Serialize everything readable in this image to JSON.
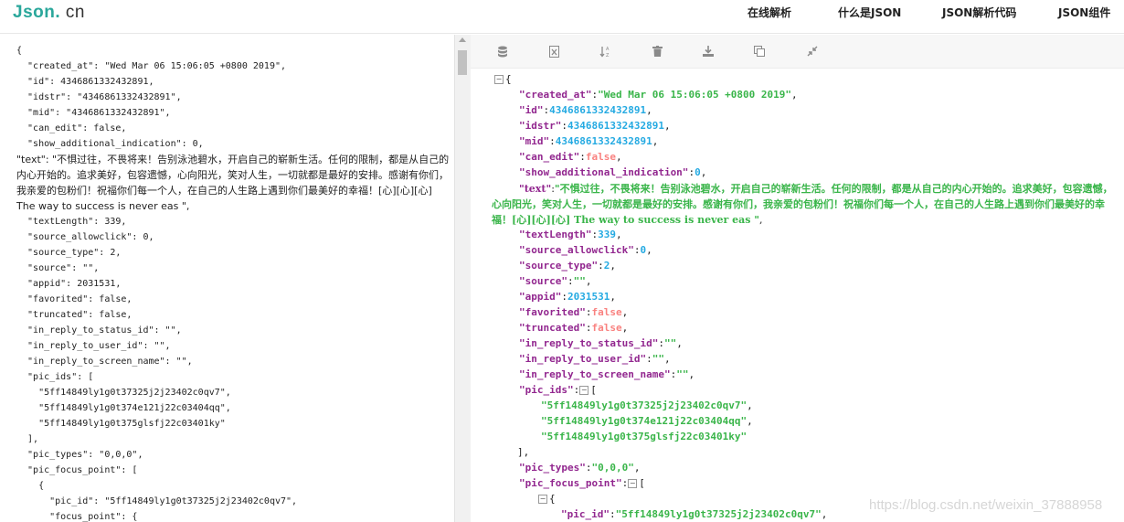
{
  "header": {
    "logo_part1": "Json",
    "logo_part2": ".",
    "logo_part3": "cn",
    "nav": [
      "在线解析",
      "什么是JSON",
      "JSON解析代码",
      "JSON组件"
    ]
  },
  "toolbar": {
    "icons": [
      "database-icon",
      "excel-export-icon",
      "sort-icon",
      "delete-icon",
      "download-icon",
      "copy-icon",
      "compress-icon"
    ]
  },
  "left_lines": [
    "{",
    "  \"created_at\": \"Wed Mar 06 15:06:05 +0800 2019\",",
    "  \"id\": 4346861332432891,",
    "  \"idstr\": \"4346861332432891\",",
    "  \"mid\": \"4346861332432891\",",
    "  \"can_edit\": false,",
    "  \"show_additional_indication\": 0,"
  ],
  "left_text_field": "  \"text\": \"不惧过往，不畏将来！告别泳池碧水，开启自己的崭新生活。任何的限制，都是从自己的内心开始的。追求美好，包容遗憾，心向阳光，笑对人生，一切就都是最好的安排。感谢有你们，我亲爱的包粉们！祝福你们每一个人，在自己的人生路上遇到你们最美好的幸福！[心][心][心] The way to success is never eas \",",
  "left_lines_after": [
    "  \"textLength\": 339,",
    "  \"source_allowclick\": 0,",
    "  \"source_type\": 2,",
    "  \"source\": \"\",",
    "  \"appid\": 2031531,",
    "  \"favorited\": false,",
    "  \"truncated\": false,",
    "  \"in_reply_to_status_id\": \"\",",
    "  \"in_reply_to_user_id\": \"\",",
    "  \"in_reply_to_screen_name\": \"\",",
    "  \"pic_ids\": [",
    "    \"5ff14849ly1g0t37325j2j23402c0qv7\",",
    "    \"5ff14849ly1g0t374e121j22c03404qq\",",
    "    \"5ff14849ly1g0t375glsfj22c03401ky\"",
    "  ],",
    "  \"pic_types\": \"0,0,0\",",
    "  \"pic_focus_point\": [",
    "    {",
    "      \"pic_id\": \"5ff14849ly1g0t37325j2j23402c0qv7\",",
    "      \"focus_point\": {"
  ],
  "right": {
    "open_brace": "{",
    "rows1": [
      {
        "k": "\"created_at\"",
        "v": "\"Wed Mar 06 15:06:05 +0800 2019\"",
        "t": "str"
      },
      {
        "k": "\"id\"",
        "v": "4346861332432891",
        "t": "num"
      },
      {
        "k": "\"idstr\"",
        "v": "4346861332432891",
        "t": "num"
      },
      {
        "k": "\"mid\"",
        "v": "4346861332432891",
        "t": "num"
      },
      {
        "k": "\"can_edit\"",
        "v": "false",
        "t": "bool"
      },
      {
        "k": "\"show_additional_indication\"",
        "v": "0",
        "t": "num"
      }
    ],
    "text_key": "\"text\"",
    "text_value": "\"不惧过往，不畏将来！告别泳池碧水，开启自己的崭新生活。任何的限制，都是从自己的内心开始的。追求美好，包容遗憾，心向阳光，笑对人生，一切就都是最好的安排。感谢有你们，我亲爱的包粉们！祝福你们每一个人，在自己的人生路上遇到你们最美好的幸福！[心][心][心] The way to success is never eas \"",
    "rows2": [
      {
        "k": "\"textLength\"",
        "v": "339",
        "t": "num"
      },
      {
        "k": "\"source_allowclick\"",
        "v": "0",
        "t": "num"
      },
      {
        "k": "\"source_type\"",
        "v": "2",
        "t": "num"
      },
      {
        "k": "\"source\"",
        "v": "\"\"",
        "t": "str"
      },
      {
        "k": "\"appid\"",
        "v": "2031531",
        "t": "num"
      },
      {
        "k": "\"favorited\"",
        "v": "false",
        "t": "bool"
      },
      {
        "k": "\"truncated\"",
        "v": "false",
        "t": "bool"
      },
      {
        "k": "\"in_reply_to_status_id\"",
        "v": "\"\"",
        "t": "str"
      },
      {
        "k": "\"in_reply_to_user_id\"",
        "v": "\"\"",
        "t": "str"
      },
      {
        "k": "\"in_reply_to_screen_name\"",
        "v": "\"\"",
        "t": "str"
      }
    ],
    "pic_ids_key": "\"pic_ids\"",
    "pic_ids": [
      "\"5ff14849ly1g0t37325j2j23402c0qv7\"",
      "\"5ff14849ly1g0t374e121j22c03404qq\"",
      "\"5ff14849ly1g0t375glsfj22c03401ky\""
    ],
    "pic_types_key": "\"pic_types\"",
    "pic_types_value": "\"0,0,0\"",
    "pic_focus_key": "\"pic_focus_point\"",
    "pic_id_key": "\"pic_id\"",
    "pic_id_value": "\"5ff14849ly1g0t37325j2j23402c0qv7\""
  },
  "watermark": "https://blog.csdn.net/weixin_37888958"
}
